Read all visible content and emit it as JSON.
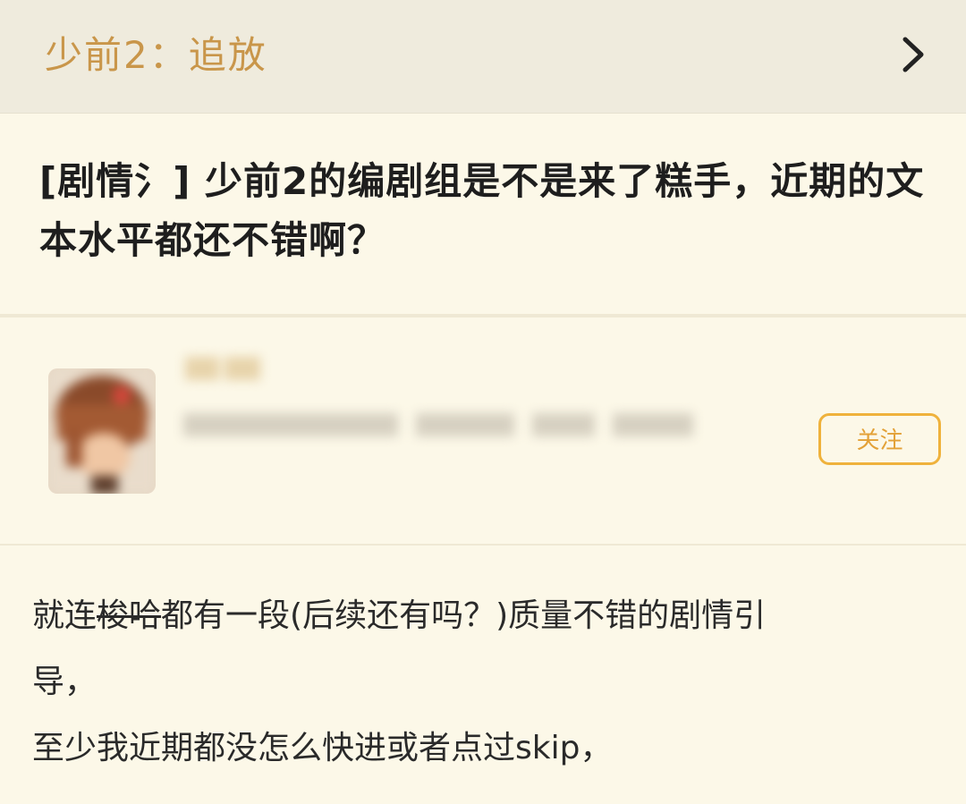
{
  "header": {
    "forum_title": "少前2：追放"
  },
  "post": {
    "title": "[剧情氵] 少前2的编剧组是不是来了糕手，近期的文本水平都还不错啊？",
    "author": {
      "follow_label": "关注"
    },
    "body": {
      "line1_prefix": "就连",
      "line1_strike": "梭哈",
      "line1_suffix": "都有一段(后续还有吗？)质量不错的剧情引",
      "line2": "导，",
      "line3": "至少我近期都没怎么快进或者点过skip，"
    }
  },
  "colors": {
    "accent": "#c9964a",
    "follow_border": "#efb23c",
    "background": "#fcf8e8",
    "header_bg": "#efebdd"
  }
}
